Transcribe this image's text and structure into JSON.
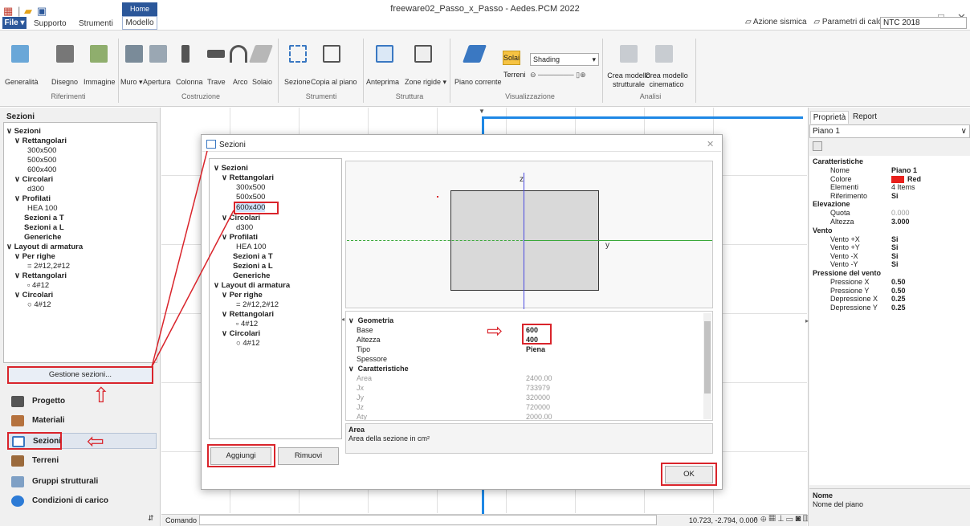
{
  "window": {
    "title": "freeware02_Passo_x_Passo - Aedes.PCM 2022"
  },
  "menu": {
    "file": "File",
    "supporto": "Supporto",
    "strumenti": "Strumenti",
    "home": "Home",
    "modello": "Modello"
  },
  "topright": {
    "azione": "Azione sismica",
    "parametri": "Parametri di calcolo",
    "ntc": "NTC 2018"
  },
  "ribbon": {
    "buttons": [
      "Generalità",
      "Disegno",
      "Immagine",
      "Muro",
      "Apertura",
      "Colonna",
      "Trave",
      "Arco",
      "Solaio",
      "Sezione",
      "Copia al piano",
      "Anteprima",
      "Zone rigide",
      "Piano corrente",
      "Solai",
      "Terreni",
      "Shading",
      "Crea modello strutturale",
      "Crea modello cinematico"
    ],
    "groups": [
      "Riferimenti",
      "Costruzione",
      "Strumenti",
      "Struttura",
      "Visualizzazione",
      "Analisi"
    ]
  },
  "left": {
    "header": "Sezioni",
    "tree": [
      "Sezioni",
      "Rettangolari",
      "300x500",
      "500x500",
      "600x400",
      "Circolari",
      "d300",
      "Profilati",
      "HEA 100",
      "Sezioni a T",
      "Sezioni a L",
      "Generiche",
      "Layout di armatura",
      "Per righe",
      "= 2#12,2#12",
      "Rettangolari",
      "▫ 4#12",
      "Circolari",
      "○ 4#12"
    ],
    "gestione": "Gestione sezioni...",
    "nav": [
      "Progetto",
      "Materiali",
      "Sezioni",
      "Terreni",
      "Gruppi strutturali",
      "Condizioni di carico"
    ]
  },
  "command": {
    "label": "Comando",
    "coords": "10.723, -2.794, 0.000"
  },
  "right": {
    "tabs": [
      "Proprietà",
      "Report"
    ],
    "selector": "Piano 1",
    "rows": [
      [
        "Caratteristiche",
        ""
      ],
      [
        "Nome",
        "Piano 1"
      ],
      [
        "Colore",
        "Red"
      ],
      [
        "Elementi",
        "4 Items"
      ],
      [
        "Riferimento",
        "Si"
      ],
      [
        "Elevazione",
        ""
      ],
      [
        "Quota",
        "0.000"
      ],
      [
        "Altezza",
        "3.000"
      ],
      [
        "Vento",
        ""
      ],
      [
        "Vento +X",
        "Si"
      ],
      [
        "Vento +Y",
        "Si"
      ],
      [
        "Vento -X",
        "Si"
      ],
      [
        "Vento -Y",
        "Si"
      ],
      [
        "Pressione del vento",
        ""
      ],
      [
        "Pressione X",
        "0.50"
      ],
      [
        "Pressione Y",
        "0.50"
      ],
      [
        "Depressione X",
        "0.25"
      ],
      [
        "Depressione Y",
        "0.25"
      ]
    ],
    "footer_title": "Nome",
    "footer_desc": "Nome del piano"
  },
  "dialog": {
    "title": "Sezioni",
    "axis_z": "z",
    "axis_y": "y",
    "geometria": "Geometria",
    "props": [
      [
        "Base",
        "600"
      ],
      [
        "Altezza",
        "400"
      ],
      [
        "Tipo",
        "Piena"
      ],
      [
        "Spessore",
        ""
      ]
    ],
    "caratteristiche": "Caratteristiche",
    "chars": [
      [
        "Area",
        "2400.00"
      ],
      [
        "Jx",
        "733979"
      ],
      [
        "Jy",
        "320000"
      ],
      [
        "Jz",
        "720000"
      ],
      [
        "Aty",
        "2000.00"
      ]
    ],
    "info_title": "Area",
    "info_desc": "Area della sezione in cm²",
    "aggiungi": "Aggiungi",
    "rimuovi": "Rimuovi",
    "ok": "OK"
  },
  "colors": {
    "accent": "#2b579a",
    "highlight": "#d9242b",
    "selection_blue": "#1e88e5"
  }
}
